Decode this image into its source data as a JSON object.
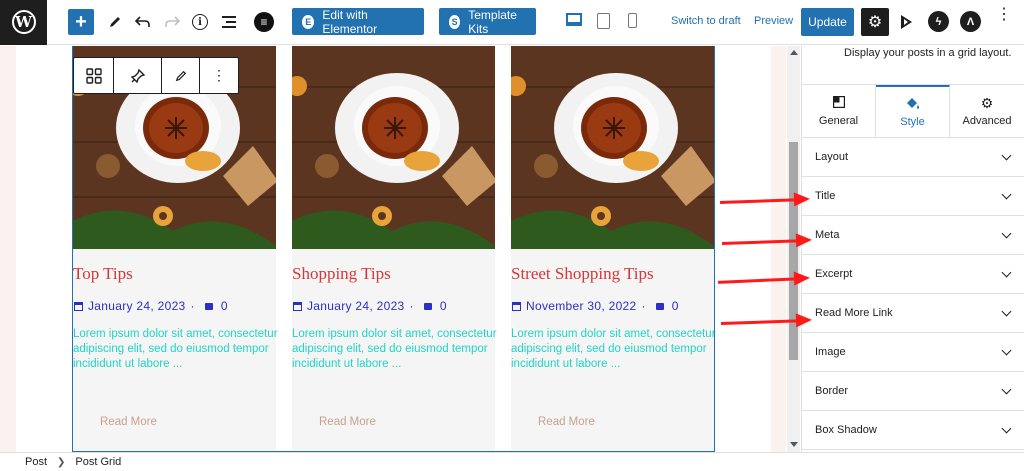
{
  "toolbar": {
    "edit_elementor": "Edit with Elementor",
    "template_kits": "Template Kits",
    "switch_draft": "Switch to draft",
    "preview": "Preview",
    "update": "Update"
  },
  "cards": [
    {
      "title": "Top Tips",
      "date": "January 24, 2023",
      "comments": "0",
      "excerpt": "Lorem ipsum dolor sit amet, consectetur adipiscing elit, sed do eiusmod tempor incididunt ut labore ...",
      "read_more": "Read More"
    },
    {
      "title": "Shopping Tips",
      "date": "January 24, 2023",
      "comments": "0",
      "excerpt": "Lorem ipsum dolor sit amet, consectetur adipiscing elit, sed do eiusmod tempor incididunt ut labore ...",
      "read_more": "Read More"
    },
    {
      "title": "Street Shopping Tips",
      "date": "November 30, 2022",
      "comments": "0",
      "excerpt": "Lorem ipsum dolor sit amet, consectetur adipiscing elit, sed do eiusmod tempor incididunt ut labore ...",
      "read_more": "Read More"
    }
  ],
  "sidebar": {
    "description": "Display your posts in a grid layout.",
    "tabs": [
      {
        "label": "General",
        "icon": "layout-icon"
      },
      {
        "label": "Style",
        "icon": "paint-bucket-icon"
      },
      {
        "label": "Advanced",
        "icon": "gear-icon"
      }
    ],
    "panels": [
      "Layout",
      "Title",
      "Meta",
      "Excerpt",
      "Read More Link",
      "Image",
      "Border",
      "Box Shadow"
    ]
  },
  "breadcrumb": [
    "Post",
    "Post Grid"
  ],
  "colors": {
    "accent": "#2271b1",
    "title": "#d63638",
    "meta": "#2b2fc4",
    "excerpt": "#21d4c4",
    "read_more": "#c9a28e",
    "arrow": "#ff1a1a"
  }
}
